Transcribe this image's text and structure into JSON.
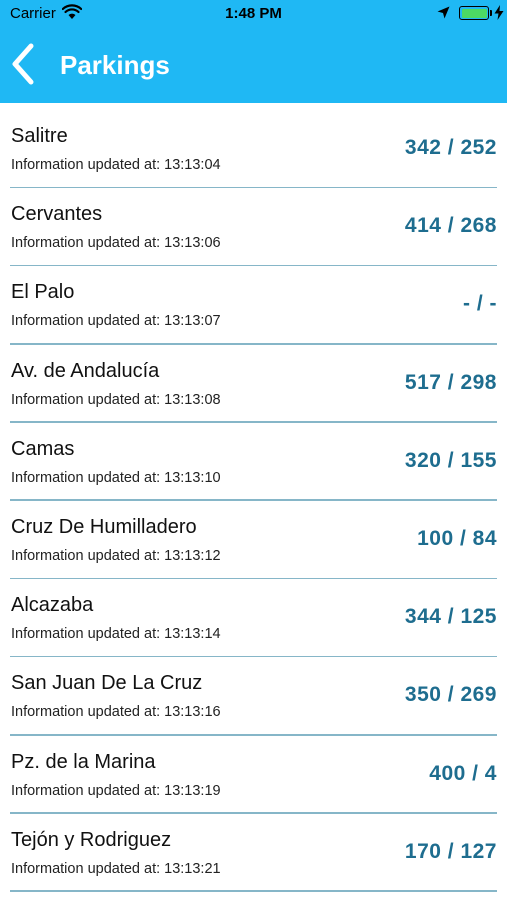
{
  "status_bar": {
    "carrier": "Carrier",
    "time": "1:48 PM",
    "icons": [
      "wifi-icon",
      "location-arrow-icon",
      "battery-icon",
      "charging-bolt-icon"
    ],
    "battery_color": "#4cd964"
  },
  "nav": {
    "title": "Parkings",
    "back_icon": "chevron-left-icon",
    "background": "#1fb8f4"
  },
  "list": {
    "updated_label": "Information updated at:",
    "count_color": "#1e6d8f",
    "items": [
      {
        "name": "Salitre",
        "updated": "13:13:04",
        "counts": "342 / 252"
      },
      {
        "name": "Cervantes",
        "updated": "13:13:06",
        "counts": "414 / 268"
      },
      {
        "name": "El Palo",
        "updated": "13:13:07",
        "counts": "- / -"
      },
      {
        "name": "Av. de Andalucía",
        "updated": "13:13:08",
        "counts": "517 / 298"
      },
      {
        "name": "Camas",
        "updated": "13:13:10",
        "counts": "320 / 155"
      },
      {
        "name": "Cruz De Humilladero",
        "updated": "13:13:12",
        "counts": "100 / 84"
      },
      {
        "name": "Alcazaba",
        "updated": "13:13:14",
        "counts": "344 / 125"
      },
      {
        "name": "San Juan De La Cruz",
        "updated": "13:13:16",
        "counts": "350 / 269"
      },
      {
        "name": "Pz. de la Marina",
        "updated": "13:13:19",
        "counts": "400 / 4"
      },
      {
        "name": "Tejón y Rodriguez",
        "updated": "13:13:21",
        "counts": "170 / 127"
      }
    ]
  }
}
